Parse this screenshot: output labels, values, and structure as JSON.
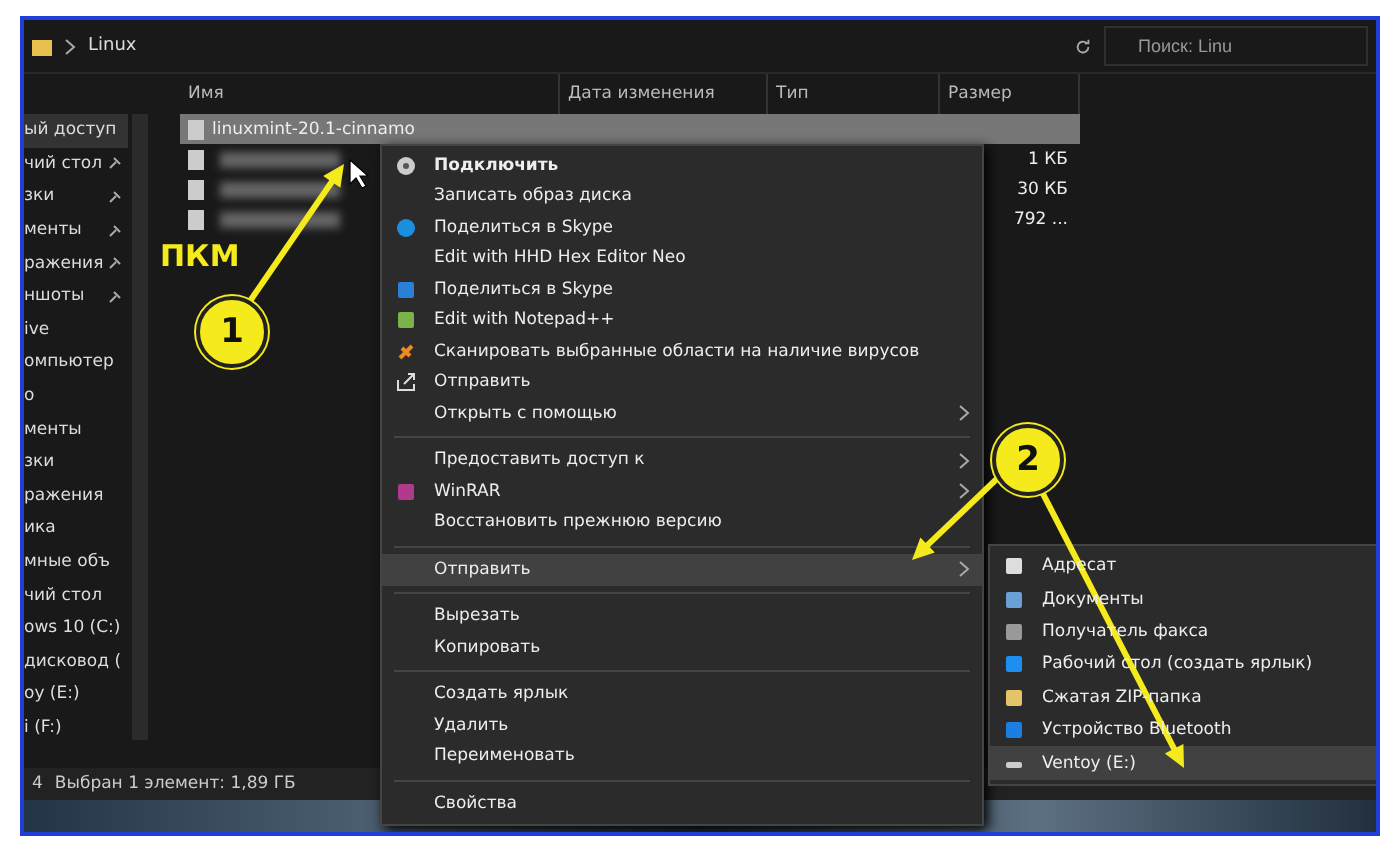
{
  "address_bar": {
    "path": "Linux",
    "search": {
      "placeholder": "Поиск: Linu"
    }
  },
  "sidebar": {
    "items": [
      {
        "label": "ый доступ",
        "pinned": false,
        "selected": true
      },
      {
        "label": "чий стол",
        "pinned": true
      },
      {
        "label": "зки",
        "pinned": true
      },
      {
        "label": "менты",
        "pinned": true
      },
      {
        "label": "ражения",
        "pinned": true
      },
      {
        "label": "ншоты",
        "pinned": true
      },
      {
        "label": "ive",
        "pinned": false
      },
      {
        "label": "омпьютер",
        "pinned": false
      },
      {
        "label": "о",
        "pinned": false
      },
      {
        "label": "менты",
        "pinned": false
      },
      {
        "label": "зки",
        "pinned": false
      },
      {
        "label": "ражения",
        "pinned": false
      },
      {
        "label": "ика",
        "pinned": false
      },
      {
        "label": "мные объ",
        "pinned": false
      },
      {
        "label": "чий стол",
        "pinned": false
      },
      {
        "label": "ows 10 (C:)"
      },
      {
        "label": "дисковод ("
      },
      {
        "label": "оу (E:)",
        "pinned": false
      },
      {
        "label": "i (F:)",
        "pinned": false
      }
    ]
  },
  "table": {
    "columns": [
      "Имя",
      "Дата изменения",
      "Тип",
      "Размер"
    ],
    "rows": [
      {
        "name": "linuxmint-20.1-cinnamo",
        "blurred": false,
        "selected": true,
        "size": ""
      },
      {
        "name": "",
        "blurred": true,
        "selected": false,
        "size": "1 КБ"
      },
      {
        "name": "",
        "blurred": true,
        "selected": false,
        "size": "30 КБ"
      },
      {
        "name": "",
        "blurred": true,
        "selected": false,
        "size": "792 ..."
      }
    ]
  },
  "context_menu": {
    "items": [
      {
        "kind": "item",
        "label": "Подключить",
        "bold": true,
        "submenu": false,
        "selected": false
      },
      {
        "kind": "item",
        "label": "Записать образ диска",
        "bold": false,
        "submenu": false,
        "selected": false
      },
      {
        "kind": "item",
        "label": "Поделиться в Skype",
        "bold": false,
        "submenu": false,
        "selected": false
      },
      {
        "kind": "item",
        "label": "Edit with HHD Hex Editor Neo",
        "bold": false,
        "submenu": false,
        "selected": false
      },
      {
        "kind": "item",
        "label": "Поделиться в Skype",
        "bold": false,
        "submenu": false,
        "selected": false
      },
      {
        "kind": "item",
        "label": "Edit with Notepad++",
        "bold": false,
        "submenu": false,
        "selected": false
      },
      {
        "kind": "item",
        "label": "Сканировать выбранные области на наличие вирусов",
        "bold": false,
        "submenu": false,
        "selected": false
      },
      {
        "kind": "item",
        "label": "Отправить",
        "bold": false,
        "submenu": false,
        "selected": false
      },
      {
        "kind": "item",
        "label": "Открыть с помощью",
        "bold": false,
        "submenu": true,
        "selected": false
      },
      {
        "kind": "separator"
      },
      {
        "kind": "item",
        "label": "Предоставить доступ к",
        "bold": false,
        "submenu": true,
        "selected": false
      },
      {
        "kind": "item",
        "label": "WinRAR",
        "bold": false,
        "submenu": true,
        "selected": false
      },
      {
        "kind": "item",
        "label": "Восстановить прежнюю версию",
        "bold": false,
        "submenu": false,
        "selected": false
      },
      {
        "kind": "separator"
      },
      {
        "kind": "item",
        "label": "Отправить",
        "bold": false,
        "submenu": true,
        "selected": true
      },
      {
        "kind": "separator"
      },
      {
        "kind": "item",
        "label": "Вырезать",
        "bold": false,
        "submenu": false,
        "selected": false
      },
      {
        "kind": "item",
        "label": "Копировать",
        "bold": false,
        "submenu": false,
        "selected": false
      },
      {
        "kind": "separator"
      },
      {
        "kind": "item",
        "label": "Создать ярлык",
        "bold": false,
        "submenu": false,
        "selected": false
      },
      {
        "kind": "item",
        "label": "Удалить",
        "bold": false,
        "submenu": false,
        "selected": false
      },
      {
        "kind": "item",
        "label": "Переименовать",
        "bold": false,
        "submenu": false,
        "selected": false
      },
      {
        "kind": "separator"
      },
      {
        "kind": "item",
        "label": "Свойства",
        "bold": false,
        "submenu": false,
        "selected": false
      }
    ]
  },
  "send_to_menu": {
    "items": [
      {
        "label": "Адресат",
        "selected": false
      },
      {
        "label": "Документы",
        "selected": false
      },
      {
        "label": "Получатель факса",
        "selected": false
      },
      {
        "label": "Рабочий стол (создать ярлык)",
        "selected": false
      },
      {
        "label": "Сжатая ZIP-папка",
        "selected": false
      },
      {
        "label": "Устройство Bluetooth",
        "selected": false
      },
      {
        "label": "Ventoy (E:)",
        "selected": true
      }
    ]
  },
  "status_bar": {
    "count": "4",
    "selection": "Выбран 1 элемент: 1,89 ГБ"
  },
  "annotations": {
    "label": "ПКМ",
    "markers": [
      "1",
      "2"
    ]
  }
}
